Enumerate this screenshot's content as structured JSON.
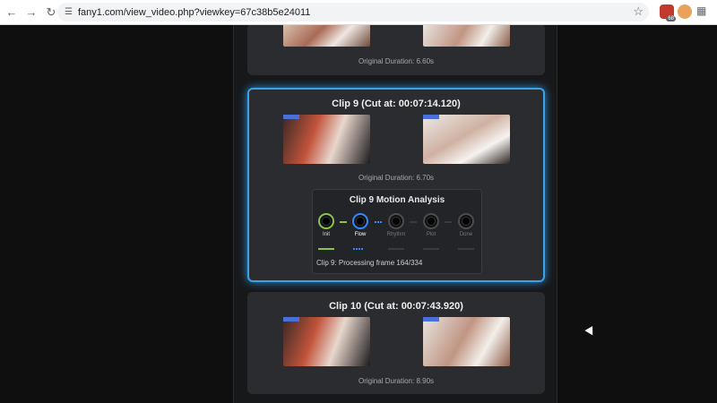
{
  "browser": {
    "url": "fany1.com/view_video.php?viewkey=67c38b5e24011",
    "nav_icons": [
      "back-arrow-icon",
      "forward-arrow-icon",
      "reload-icon",
      "site-info-icon"
    ],
    "extension_badge": "68"
  },
  "clips": [
    {
      "title": "",
      "duration": "Original Duration: 6.60s"
    },
    {
      "title": "Clip 9 (Cut at: 00:07:14.120)",
      "duration": "Original Duration: 6.70s",
      "analysis": {
        "title": "Clip 9 Motion Analysis",
        "stages": [
          {
            "label": "Init",
            "state": "done"
          },
          {
            "label": "Flow",
            "state": "active"
          },
          {
            "label": "Rhythm",
            "state": "pending"
          },
          {
            "label": "Plot",
            "state": "pending"
          },
          {
            "label": "Done",
            "state": "pending"
          }
        ],
        "status": "Clip 9: Processing frame 164/334"
      }
    },
    {
      "title": "Clip 10 (Cut at: 00:07:43.920)",
      "duration": "Original Duration: 8.90s"
    }
  ]
}
